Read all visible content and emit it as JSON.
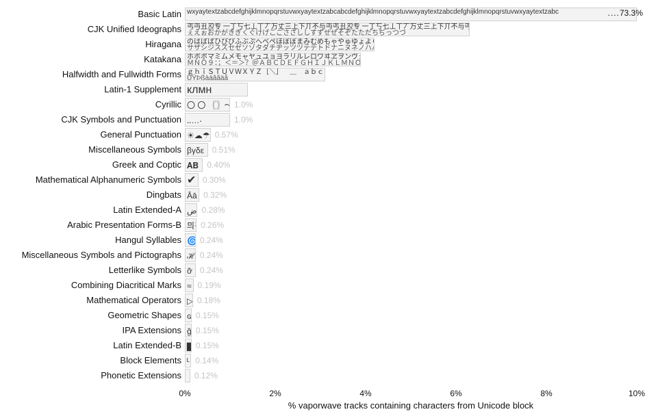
{
  "chart_data": {
    "type": "bar",
    "orientation": "horizontal",
    "title": "",
    "xlabel": "% vaporwave tracks containing characters from Unicode block",
    "ylabel": "",
    "xlim": [
      0,
      10
    ],
    "x_ticks": [
      0,
      2,
      4,
      6,
      8,
      10
    ],
    "x_tick_labels": [
      "0%",
      "2%",
      "4%",
      "6%",
      "8%",
      "10%"
    ],
    "categories": [
      "Basic Latin",
      "CJK Unified Ideographs",
      "Hiragana",
      "Katakana",
      "Halfwidth and Fullwidth Forms",
      "Latin-1 Supplement",
      "Cyrillic",
      "CJK Symbols and Punctuation",
      "General Punctuation",
      "Miscellaneous Symbols",
      "Greek and Coptic",
      "Mathematical Alphanumeric Symbols",
      "Dingbats",
      "Latin Extended-A",
      "Arabic Presentation Forms-B",
      "Hangul Syllables",
      "Miscellaneous Symbols and Pictographs",
      "Letterlike Symbols",
      "Combining Diacritical Marks",
      "Mathematical Operators",
      "Geometric Shapes",
      "IPA Extensions",
      "Latin Extended-B",
      "Block Elements",
      "Phonetic Extensions"
    ],
    "values": [
      73.3,
      6.3,
      4.2,
      3.9,
      3.1,
      1.4,
      1.0,
      1.0,
      0.57,
      0.51,
      0.4,
      0.3,
      0.32,
      0.28,
      0.26,
      0.24,
      0.24,
      0.24,
      0.19,
      0.18,
      0.15,
      0.15,
      0.15,
      0.14,
      0.12
    ],
    "overflow": [
      true,
      false,
      false,
      false,
      false,
      false,
      false,
      false,
      false,
      false,
      false,
      false,
      false,
      false,
      false,
      false,
      false,
      false,
      false,
      false,
      false,
      false,
      false,
      false,
      false
    ],
    "bar_samples": [
      "wxyaytextzabcdefghijklmnopqrstuvwxyaytextzabcabcdefghijklmnopqrstuvwxyaytextzabcdefghijklmnopqrstuvwxyaytextzabc",
      "丐丏丑丒专 一丁丂七丄丅丆万丈三上下丌不与丏丐丑丒专 一丁丂七丄丅丆万丈三上下丌不与丏丐丑丒专",
      "ぇえぉおかがきぎくぐけげこごさざししすずせぜそぞたただちぢっつづ",
      "のはばぱひびぴふぶぷへべぺほぼぽまみむめもゃやゅゆょよらりる",
      "サザシジスズセゼソゾタダチヂッツヅテデトドナニヌネノハバパ",
      "ホボポマミムメモャヤュユョヨラリルレロワヰヱヲンヴヵヶ",
      "ＭＮＯ９：；＜＝＞？＠ＡＢＣＤＥＦＧＨＩＪＫＬＭＮＯ",
      "ｇｈｉＳＴＵＶＷＸＹＺ［＼］＾＿｀ａｂｃｄｅｆｇｈｉ",
      "ÜÝÞßàáâãäå",
      "клмн",
      "〇 〇 〖〗～",
      "‥…‧",
      "☀☁☂",
      "βγδε",
      "𝐀𝐁",
      "✔",
      "Āā",
      "ﺽ",
      "믜긷",
      "🌀",
      "ℋ",
      "ỡ",
      "≈",
      "▷",
      "ɢ",
      "ğ",
      "▇",
      "ᴸ"
    ],
    "value_labels": {
      "0": "73.3%"
    },
    "annotations": [
      {
        "text": "....73.3%",
        "anchor": "top-right"
      }
    ]
  }
}
